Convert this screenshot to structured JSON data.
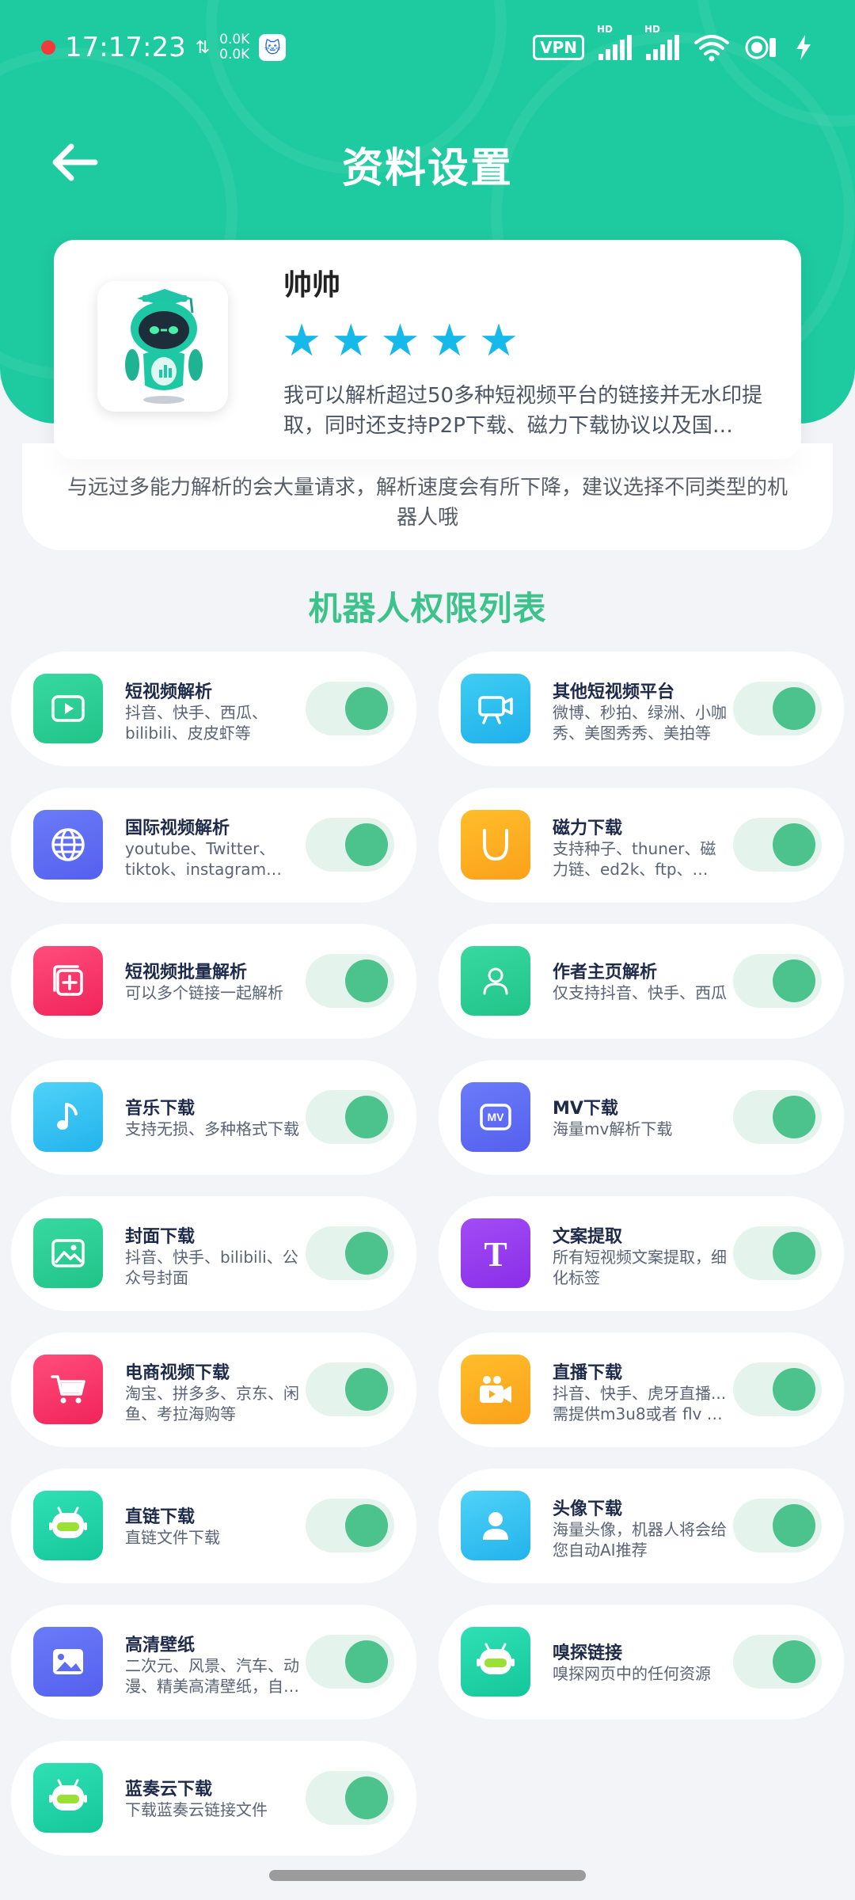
{
  "status_bar": {
    "time": "17:17:23",
    "net_up": "0.0K",
    "net_down": "0.0K",
    "vpn": "VPN",
    "hd1": "HD",
    "hd2": "HD",
    "wifi_badge": "5"
  },
  "nav": {
    "title": "资料设置"
  },
  "profile": {
    "name": "帅帅",
    "rating": 5,
    "description": "我可以解析超过50多种短视频平台的链接并无水印提取，同时还支持P2P下载、磁力下载协议以及国…"
  },
  "notice": {
    "line1": "与远过多能力解析的会大量请求，解析速度会有所下降，建议选择不同类型的机",
    "line2": "器人哦"
  },
  "section_title": "机器人权限列表",
  "permissions": [
    {
      "title": "短视频解析",
      "desc": "抖音、快手、西瓜、bilibili、皮皮虾等",
      "icon": "video-play-icon",
      "color_from": "#37d9a0",
      "color_to": "#22c389",
      "enabled": true
    },
    {
      "title": "其他短视频平台",
      "desc": "微博、秒拍、绿洲、小咖秀、美图秀秀、美拍等",
      "icon": "video-camera-icon",
      "color_from": "#3fcdf3",
      "color_to": "#1eb0ea",
      "enabled": true
    },
    {
      "title": "国际视频解析",
      "desc": "youtube、Twitter、tiktok、instagram…",
      "icon": "globe-icon",
      "color_from": "#6a7bf8",
      "color_to": "#5560ee",
      "enabled": true
    },
    {
      "title": "磁力下载",
      "desc": "支持种子、thuner、磁力链、ed2k、ftp、…",
      "icon": "magnet-icon",
      "color_from": "#ffbd2b",
      "color_to": "#fba11a",
      "enabled": true
    },
    {
      "title": "短视频批量解析",
      "desc": "可以多个链接一起解析",
      "icon": "batch-add-icon",
      "color_from": "#ff4d7a",
      "color_to": "#f0245a",
      "enabled": true
    },
    {
      "title": "作者主页解析",
      "desc": "仅支持抖音、快手、西瓜",
      "icon": "user-icon",
      "color_from": "#37d9a0",
      "color_to": "#22c389",
      "enabled": true
    },
    {
      "title": "音乐下载",
      "desc": "支持无损、多种格式下载",
      "icon": "music-note-icon",
      "color_from": "#4fd2f7",
      "color_to": "#22b3ec",
      "enabled": true
    },
    {
      "title": "MV下载",
      "desc": "海量mv解析下载",
      "icon": "mv-icon",
      "color_from": "#6a7bf8",
      "color_to": "#5560ee",
      "enabled": true
    },
    {
      "title": "封面下载",
      "desc": "抖音、快手、bilibili、公众号封面",
      "icon": "image-icon",
      "color_from": "#37d9a0",
      "color_to": "#22c389",
      "enabled": true
    },
    {
      "title": "文案提取",
      "desc": "所有短视频文案提取，细化标签",
      "icon": "text-icon",
      "color_from": "#a24cf4",
      "color_to": "#8a2ee8",
      "enabled": true
    },
    {
      "title": "电商视频下载",
      "desc": "淘宝、拼多多、京东、闲鱼、考拉海购等",
      "icon": "cart-icon",
      "color_from": "#ff4d7a",
      "color_to": "#f0245a",
      "enabled": true
    },
    {
      "title": "直播下载",
      "desc": "抖音、快手、虎牙直播... 需提供m3u8或者 flv …",
      "icon": "live-camera-icon",
      "color_from": "#ffbd2b",
      "color_to": "#fba11a",
      "enabled": true
    },
    {
      "title": "直链下载",
      "desc": "直链文件下载",
      "icon": "robot-icon",
      "color_from": "#2fe0b4",
      "color_to": "#14c79b",
      "enabled": true
    },
    {
      "title": "头像下载",
      "desc": "海量头像，机器人将会给您自动AI推荐",
      "icon": "avatar-icon",
      "color_from": "#4fd2f7",
      "color_to": "#22b3ec",
      "enabled": true
    },
    {
      "title": "高清壁纸",
      "desc": "二次元、风景、汽车、动漫、精美高清壁纸，自…",
      "icon": "wallpaper-icon",
      "color_from": "#6a7bf8",
      "color_to": "#5560ee",
      "enabled": true
    },
    {
      "title": "嗅探链接",
      "desc": "嗅探网页中的任何资源",
      "icon": "robot-icon",
      "color_from": "#2fe0b4",
      "color_to": "#14c79b",
      "enabled": true
    },
    {
      "title": "蓝奏云下载",
      "desc": "下载蓝奏云链接文件",
      "icon": "robot-icon",
      "color_from": "#2fe0b4",
      "color_to": "#14c79b",
      "enabled": true
    }
  ],
  "colors": {
    "header": "#1ecaa0",
    "accent_green": "#3cc28a",
    "star": "#16b9e9",
    "toggle_on": "#4cc38d"
  }
}
